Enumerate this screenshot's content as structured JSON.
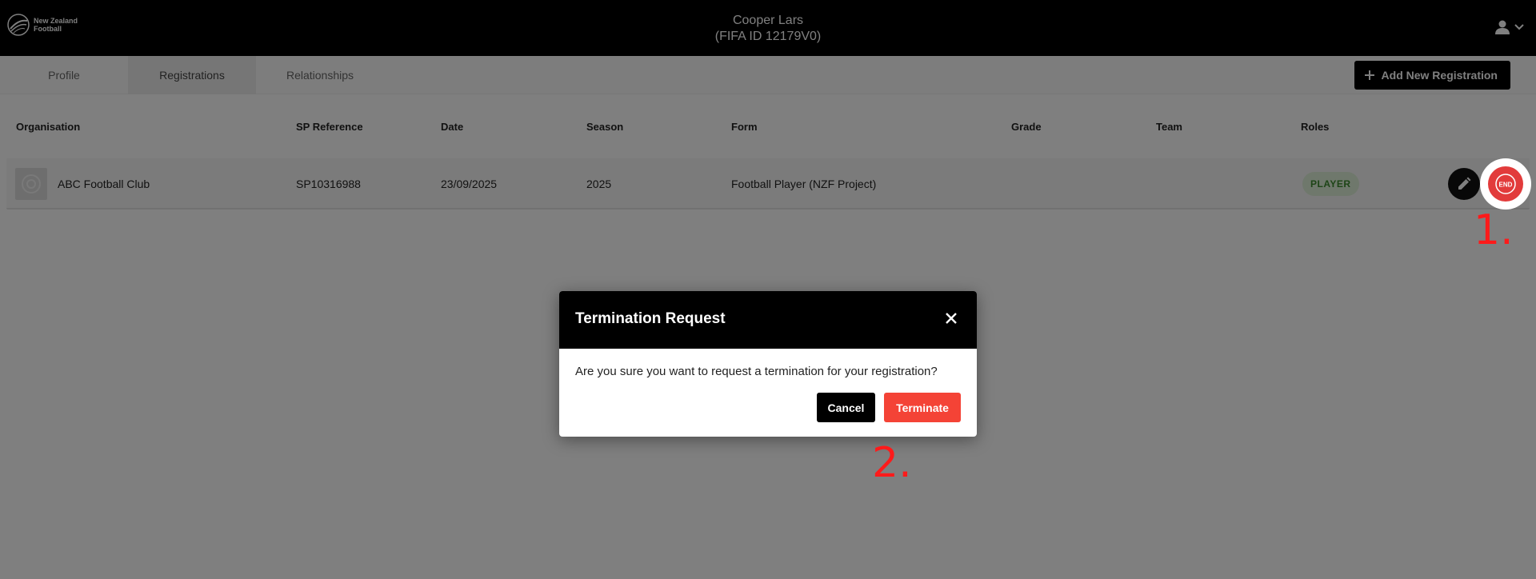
{
  "header": {
    "logo_text": "New Zealand Football",
    "player_name": "Cooper Lars",
    "fifa_id": "(FIFA ID 12179V0)",
    "user_icon": "user-icon",
    "menu_icon": "chevron-down-icon"
  },
  "tabs": [
    {
      "label": "Profile",
      "active": false
    },
    {
      "label": "Registrations",
      "active": true
    },
    {
      "label": "Relationships",
      "active": false
    }
  ],
  "toolbar": {
    "add_label": "Add New Registration",
    "add_icon": "plus-icon"
  },
  "table": {
    "columns": [
      "Organisation",
      "SP Reference",
      "Date",
      "Season",
      "Form",
      "Grade",
      "Team",
      "Roles"
    ],
    "rows": [
      {
        "organisation": "ABC Football Club",
        "sp_reference": "SP10316988",
        "date": "23/09/2025",
        "season": "2025",
        "form": "Football Player (NZF Project)",
        "grade": "",
        "team": "",
        "role": "PLAYER",
        "end_label": "END"
      }
    ]
  },
  "annotations": {
    "step1": "1.",
    "step2": "2."
  },
  "modal": {
    "title": "Termination Request",
    "message": "Are you sure you want to request a termination for your registration?",
    "cancel_label": "Cancel",
    "terminate_label": "Terminate"
  },
  "colors": {
    "accent": "#000000",
    "danger": "#f44336",
    "annotation": "#ff1a1a",
    "role_badge_text": "#3c8a2e"
  }
}
